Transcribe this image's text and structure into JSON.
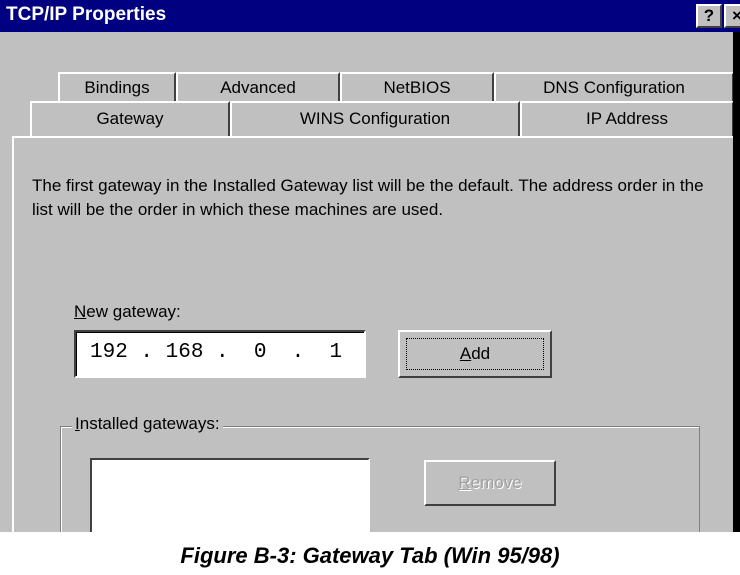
{
  "window": {
    "title": "TCP/IP Properties",
    "help_button": "?",
    "close_button": "×"
  },
  "tabs": {
    "row1": [
      "Bindings",
      "Advanced",
      "NetBIOS",
      "DNS Configuration"
    ],
    "row2": [
      "Gateway",
      "WINS Configuration",
      "IP Address"
    ],
    "active": "Gateway"
  },
  "gateway_panel": {
    "description": "The first gateway in the Installed Gateway list will be the default. The address order in the list will be the order in which these machines are used.",
    "new_gateway_label": "New gateway:",
    "new_gateway_mnemonic": "N",
    "new_gateway_rest": "ew gateway:",
    "ip_value": "192 . 168 .  0  .  1",
    "add_button": "Add",
    "add_mnemonic": "A",
    "add_rest": "dd",
    "installed_label": "Installed gateways:",
    "installed_mnemonic": "I",
    "installed_rest": "nstalled gateways:",
    "installed_gateways": [],
    "remove_button": "Remove",
    "remove_mnemonic": "R",
    "remove_rest": "emove"
  },
  "caption": "Figure B-3: Gateway Tab (Win 95/98)",
  "colors": {
    "titlebar": "#000080",
    "face": "#c0c0c0",
    "disabled_text": "#a0a0a0"
  }
}
